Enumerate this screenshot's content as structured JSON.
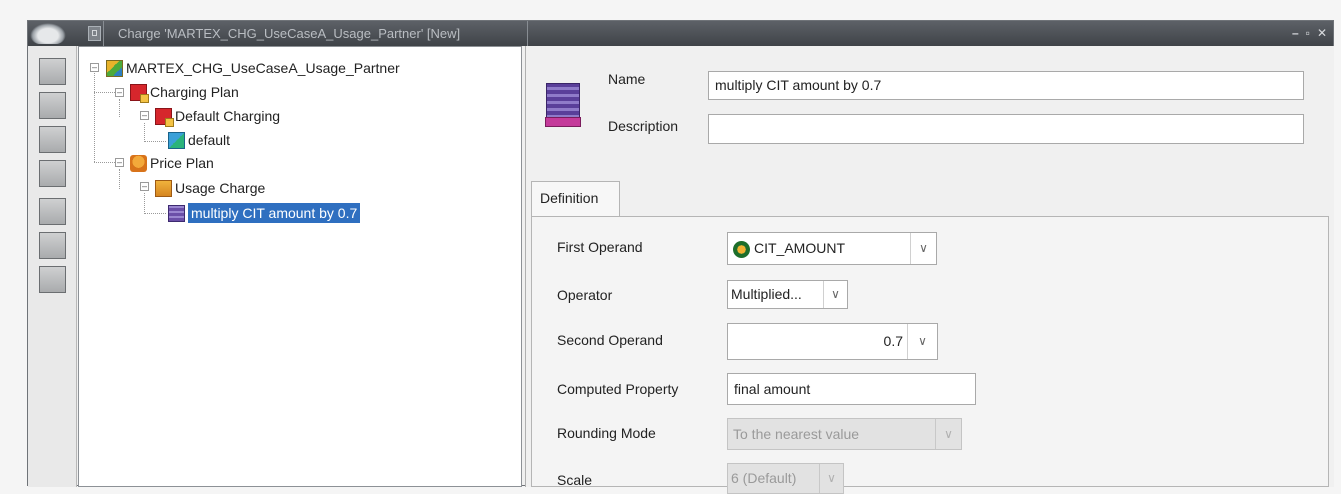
{
  "window": {
    "title": "Charge 'MARTEX_CHG_UseCaseA_Usage_Partner' [New]",
    "controls": {
      "minimize": "–",
      "restore": "▫",
      "close": "✕"
    }
  },
  "tree": {
    "root": "MARTEX_CHG_UseCaseA_Usage_Partner",
    "charging_plan": "Charging Plan",
    "default_charging": "Default Charging",
    "default": "default",
    "price_plan": "Price Plan",
    "usage_charge": "Usage Charge",
    "selected_formula": "multiply CIT amount by 0.7"
  },
  "detail": {
    "name_label": "Name",
    "name_value": "multiply CIT amount by 0.7",
    "description_label": "Description",
    "description_value": "",
    "tab_label": "Definition",
    "first_operand_label": "First Operand",
    "first_operand_value": "CIT_AMOUNT",
    "operator_label": "Operator",
    "operator_value": "Multiplied...",
    "second_operand_label": "Second Operand",
    "second_operand_value": "0.7",
    "computed_property_label": "Computed Property",
    "computed_property_value": "final amount",
    "rounding_mode_label": "Rounding Mode",
    "rounding_mode_value": "To the nearest value",
    "scale_label": "Scale",
    "scale_value": "6 (Default)"
  },
  "icons": {
    "combo_arrow": "∨"
  }
}
